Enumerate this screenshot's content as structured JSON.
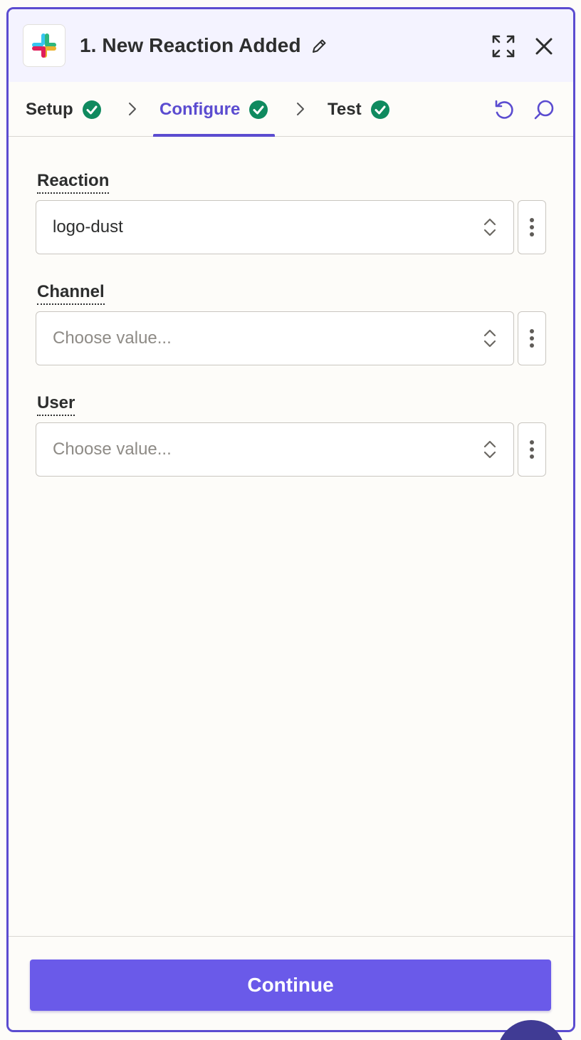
{
  "header": {
    "title": "1. New Reaction Added",
    "app_icon": "slack-logo",
    "icons": [
      "edit-icon",
      "expand-icon",
      "close-icon"
    ]
  },
  "tabs": [
    {
      "label": "Setup",
      "complete": true,
      "active": false
    },
    {
      "label": "Configure",
      "complete": true,
      "active": true
    },
    {
      "label": "Test",
      "complete": true,
      "active": false
    }
  ],
  "toolbar_icons": [
    "undo-icon",
    "search-icon"
  ],
  "fields": [
    {
      "label": "Reaction",
      "value": "logo-dust",
      "placeholder": ""
    },
    {
      "label": "Channel",
      "value": "",
      "placeholder": "Choose value..."
    },
    {
      "label": "User",
      "value": "",
      "placeholder": "Choose value..."
    }
  ],
  "footer": {
    "continue_label": "Continue"
  },
  "colors": {
    "accent": "#5b4cd0",
    "button": "#6a5ae9",
    "success": "#0f8a5f",
    "header_bg": "#f4f3ff"
  }
}
